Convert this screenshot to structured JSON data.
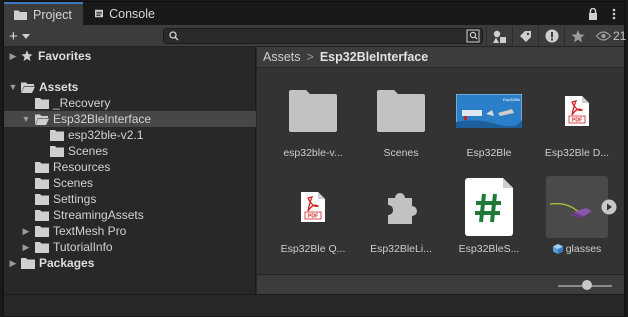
{
  "tabs": [
    {
      "label": "Project",
      "icon": "folder-icon",
      "active": true
    },
    {
      "label": "Console",
      "icon": "console-icon",
      "active": false
    }
  ],
  "toolbar": {
    "add_label": "+",
    "search_placeholder": "",
    "hidden_count": "21"
  },
  "tree": {
    "favorites": "Favorites",
    "assets": "Assets",
    "items": [
      {
        "label": "_Recovery"
      },
      {
        "label": "Esp32BleInterface"
      },
      {
        "label": "esp32ble-v2.1"
      },
      {
        "label": "Scenes"
      },
      {
        "label": "Resources"
      },
      {
        "label": "Scenes"
      },
      {
        "label": "Settings"
      },
      {
        "label": "StreamingAssets"
      },
      {
        "label": "TextMesh Pro"
      },
      {
        "label": "TutorialInfo"
      }
    ],
    "packages": "Packages"
  },
  "breadcrumb": {
    "root": "Assets",
    "separator": ">",
    "current": "Esp32BleInterface"
  },
  "assets": [
    {
      "name": "esp32ble-v...",
      "type": "folder"
    },
    {
      "name": "Scenes",
      "type": "folder"
    },
    {
      "name": "Esp32Ble",
      "type": "image"
    },
    {
      "name": "Esp32Ble D...",
      "type": "pdf"
    },
    {
      "name": "Esp32Ble Q...",
      "type": "pdf"
    },
    {
      "name": "Esp32BleLi...",
      "type": "plugin"
    },
    {
      "name": "Esp32BleS...",
      "type": "script"
    },
    {
      "name": "glasses",
      "type": "model"
    }
  ],
  "pdf_badge": "PDF",
  "thumb_label": "Esp32Ble",
  "colors": {
    "accent": "#3a79bb",
    "selection": "#474747",
    "pdf_red": "#d32121",
    "script_green": "#1f7a3a"
  }
}
